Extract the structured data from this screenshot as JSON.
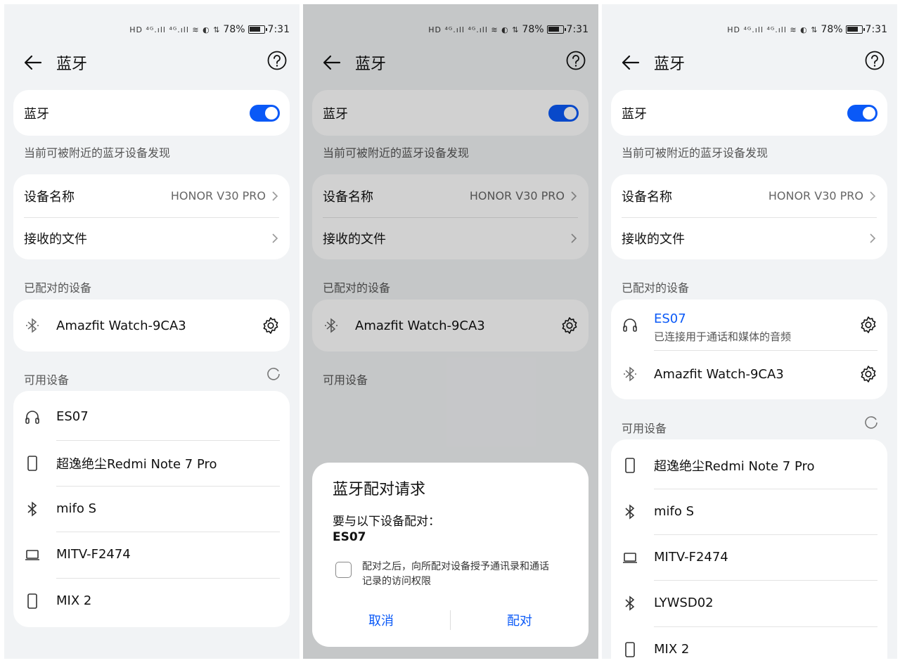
{
  "status_bar": {
    "network_icons": "HD ⁴ᴳ.ıll ⁴ᴳ.ıll ≋ ◐ ⇅",
    "battery": "78%",
    "time": "7:31"
  },
  "colors": {
    "accent": "#0a59f7",
    "background": "#f1f3f5",
    "card": "#ffffff"
  },
  "header": {
    "title": "蓝牙"
  },
  "bluetooth": {
    "label": "蓝牙",
    "enabled": true,
    "discoverable_note": "当前可被附近的蓝牙设备发现"
  },
  "settings": {
    "device_name_label": "设备名称",
    "device_name_value": "HONOR V30 PRO",
    "received_files_label": "接收的文件"
  },
  "sections": {
    "paired": "已配对的设备",
    "available": "可用设备"
  },
  "panel1": {
    "paired": [
      {
        "name": "Amazfit Watch-9CA3",
        "icon": "bluetooth-icon"
      }
    ],
    "available": [
      {
        "name": "ES07",
        "icon": "headphones-icon"
      },
      {
        "name": "超逸绝尘Redmi Note 7 Pro",
        "icon": "phone-icon"
      },
      {
        "name": "mifo S",
        "icon": "bluetooth-icon"
      },
      {
        "name": "MITV-F2474",
        "icon": "laptop-icon"
      },
      {
        "name": "MIX 2",
        "icon": "phone-icon"
      }
    ]
  },
  "panel2": {
    "paired": [
      {
        "name": "Amazfit Watch-9CA3",
        "icon": "bluetooth-icon"
      }
    ],
    "dialog": {
      "title": "蓝牙配对请求",
      "prompt": "要与以下设备配对：",
      "device": "ES07",
      "checkbox_line1": "配对之后，向所配对设备授予通讯录和通话",
      "checkbox_line2": "记录的访问权限",
      "cancel": "取消",
      "pair": "配对"
    }
  },
  "panel3": {
    "paired": [
      {
        "name": "ES07",
        "status": "已连接用于通话和媒体的音频",
        "icon": "headphones-icon"
      },
      {
        "name": "Amazfit Watch-9CA3",
        "icon": "bluetooth-icon"
      }
    ],
    "available": [
      {
        "name": "超逸绝尘Redmi Note 7 Pro",
        "icon": "phone-icon"
      },
      {
        "name": "mifo S",
        "icon": "bluetooth-icon"
      },
      {
        "name": "MITV-F2474",
        "icon": "laptop-icon"
      },
      {
        "name": "LYWSD02",
        "icon": "bluetooth-icon"
      },
      {
        "name": "MIX 2",
        "icon": "phone-icon"
      }
    ]
  }
}
